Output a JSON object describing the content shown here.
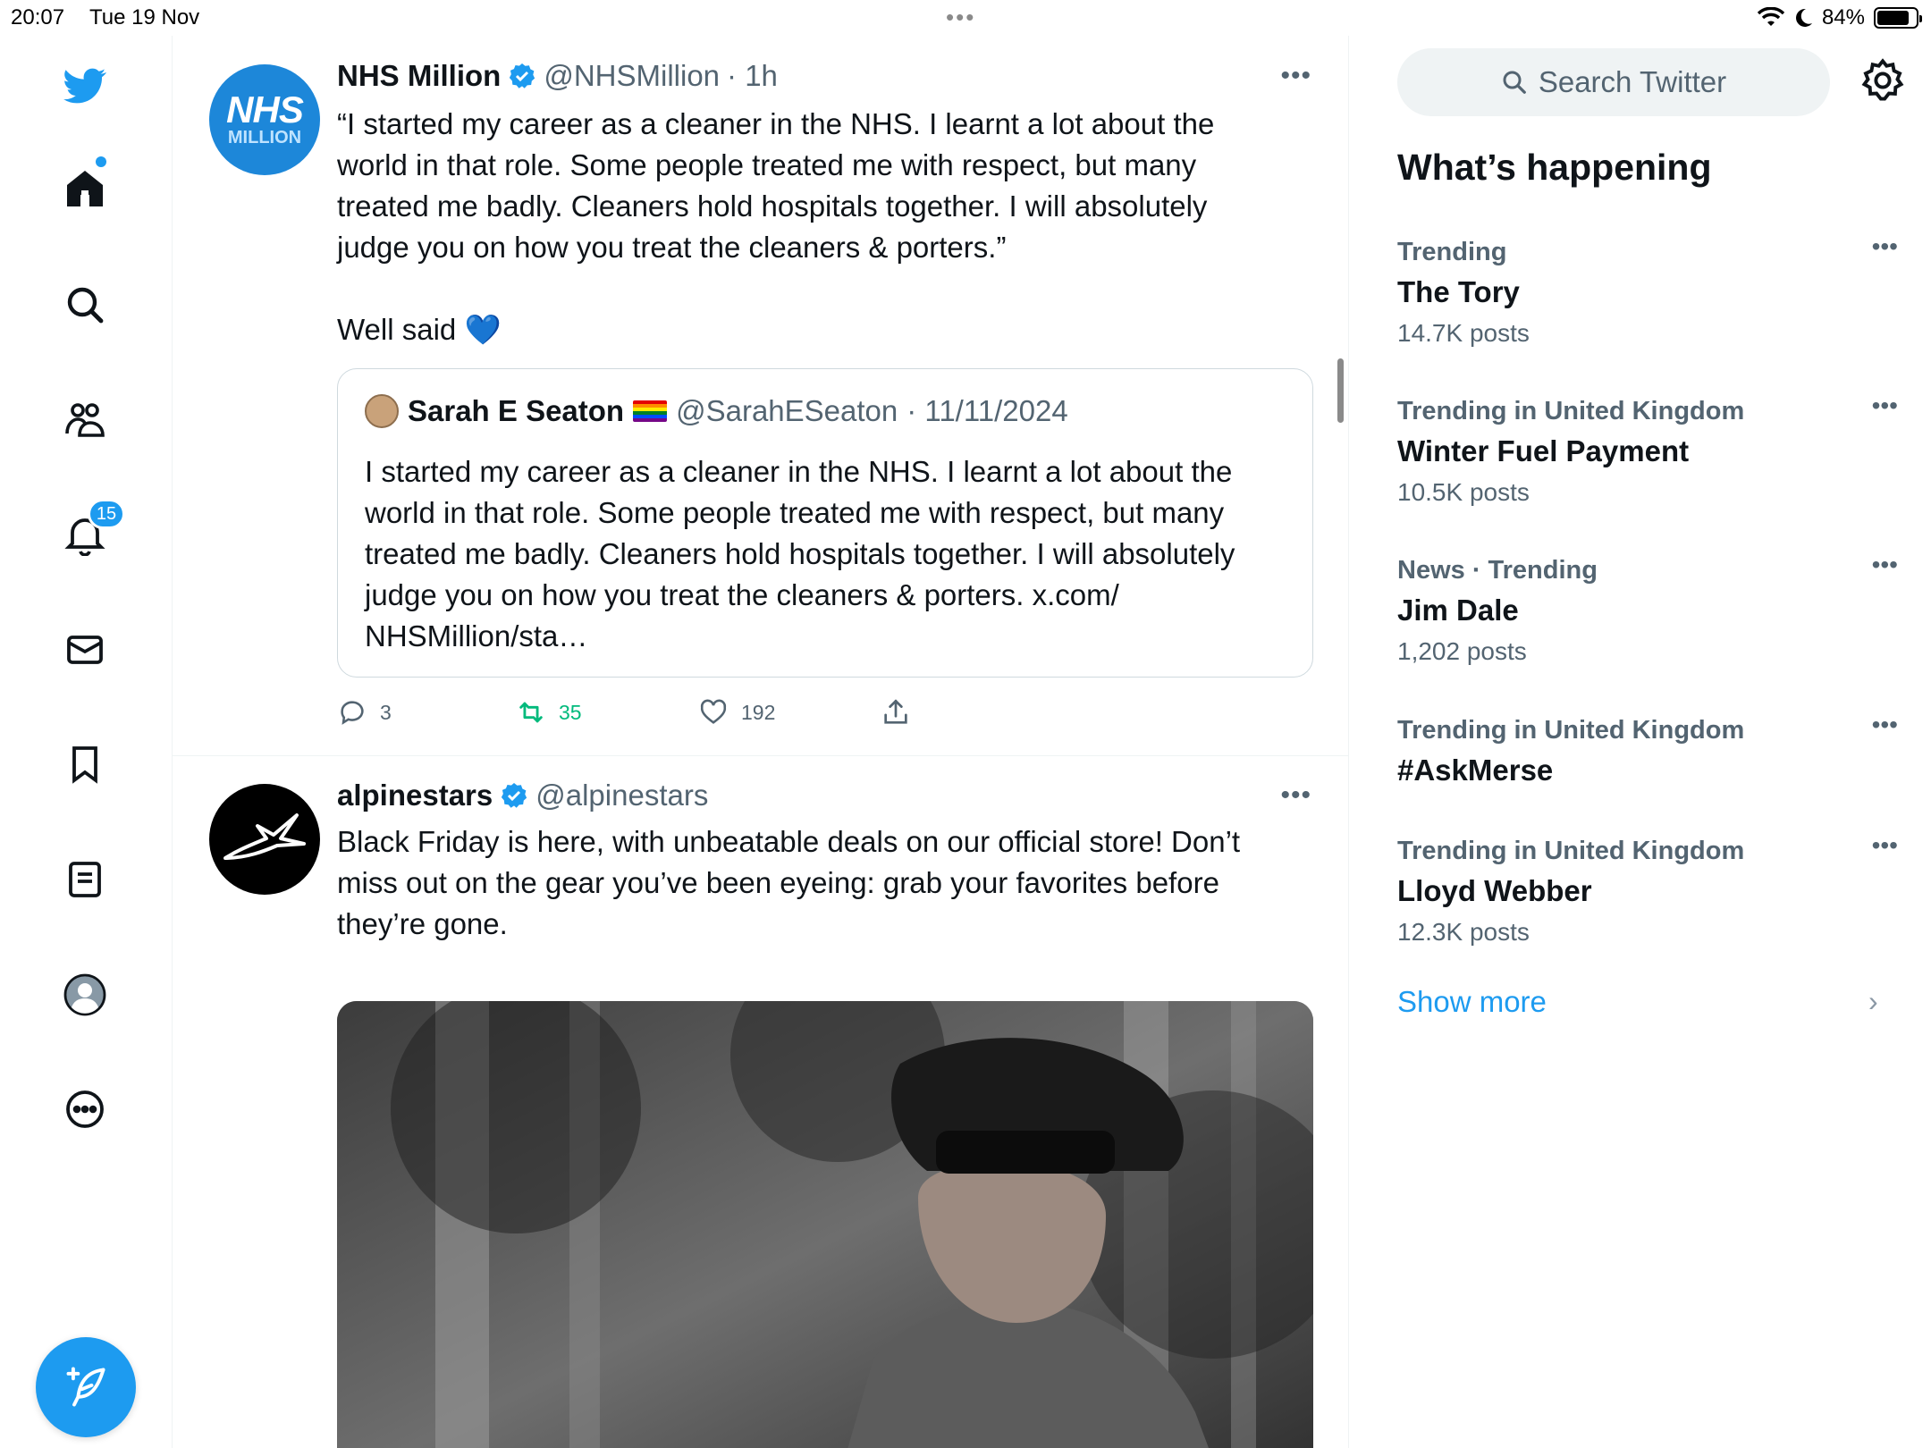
{
  "status": {
    "time": "20:07",
    "date": "Tue 19 Nov",
    "battery_percent_text": "84%",
    "battery_level": 0.84
  },
  "nav": {
    "notifications_badge": "15",
    "accent": "#1d9bf0"
  },
  "tweets": [
    {
      "name": "NHS Million",
      "handle": "@NHSMillion",
      "time": "· 1h",
      "avatar_big": "NHS",
      "avatar_small": "MILLION",
      "text": "“I started my career as a cleaner in the NHS. I learnt a lot about the\nworld in that role. Some people treated me with respect, but many\ntreated me badly. Cleaners hold hospitals together. I will absolutely\njudge you on how you treat the cleaners & porters.”\n\nWell said 💙",
      "quote": {
        "name": "Sarah E Seaton",
        "handle": "@SarahESeaton",
        "date": "· 11/11/2024",
        "text": "I started my career as a cleaner in the NHS. I learnt a lot about the\nworld in that role. Some people treated me with respect, but many\ntreated me badly. Cleaners hold hospitals together. I will absolutely\njudge you on how you treat the cleaners & porters. x.com/\nNHSMillion/sta…"
      },
      "replies": "3",
      "retweets": "35",
      "likes": "192"
    },
    {
      "name": "alpinestars",
      "handle": "@alpinestars",
      "text": "Black Friday is here, with unbeatable deals on our official store! Don’t\nmiss out on the gear you’ve been eyeing: grab your favorites before\nthey’re gone."
    }
  ],
  "sidebar": {
    "search_placeholder": "Search Twitter",
    "title": "What’s happening",
    "trends": [
      {
        "category": "Trending",
        "name": "The Tory",
        "count": "14.7K posts"
      },
      {
        "category": "Trending in United Kingdom",
        "name": "Winter Fuel Payment",
        "count": "10.5K posts"
      },
      {
        "category": "News · Trending",
        "name": "Jim Dale",
        "count": "1,202 posts"
      },
      {
        "category": "Trending in United Kingdom",
        "name": "#AskMerse",
        "count": ""
      },
      {
        "category": "Trending in United Kingdom",
        "name": "Lloyd Webber",
        "count": "12.3K posts"
      }
    ],
    "show_more": "Show more"
  }
}
